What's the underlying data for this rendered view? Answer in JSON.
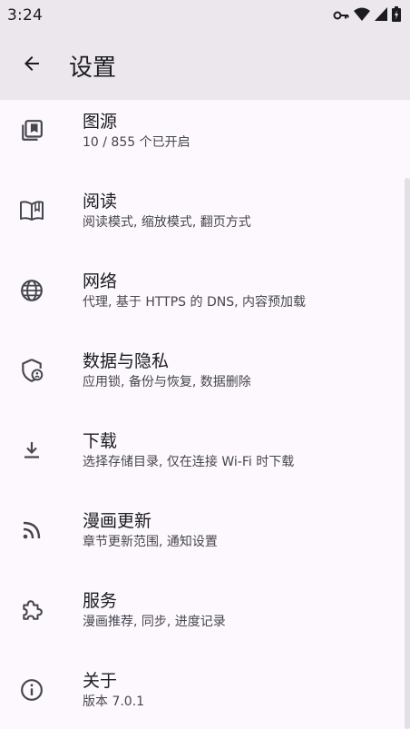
{
  "status": {
    "time": "3:24"
  },
  "header": {
    "title": "设置"
  },
  "settings": [
    {
      "label": "图源",
      "sub": "10 / 855 个已开启",
      "icon": "library-icon"
    },
    {
      "label": "阅读",
      "sub": "阅读模式, 缩放模式, 翻页方式",
      "icon": "book-icon"
    },
    {
      "label": "网络",
      "sub": "代理, 基于 HTTPS 的 DNS, 内容预加载",
      "icon": "globe-icon"
    },
    {
      "label": "数据与隐私",
      "sub": "应用锁, 备份与恢复, 数据删除",
      "icon": "shield-lock-icon"
    },
    {
      "label": "下载",
      "sub": "选择存储目录, 仅在连接 Wi-Fi 时下载",
      "icon": "download-icon"
    },
    {
      "label": "漫画更新",
      "sub": "章节更新范围, 通知设置",
      "icon": "rss-icon"
    },
    {
      "label": "服务",
      "sub": "漫画推荐, 同步, 进度记录",
      "icon": "puzzle-icon"
    },
    {
      "label": "关于",
      "sub": "版本 7.0.1",
      "icon": "info-icon"
    }
  ]
}
